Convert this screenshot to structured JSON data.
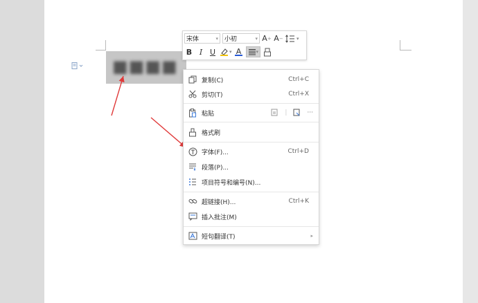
{
  "toolbar": {
    "font_name": "宋体",
    "font_size": "小初",
    "bold": "B",
    "italic": "I",
    "underline": "U",
    "grow_font": "A",
    "shrink_font": "A",
    "font_color_glyph": "A"
  },
  "menu": {
    "copy": {
      "label": "复制(C)",
      "shortcut": "Ctrl+C"
    },
    "cut": {
      "label": "剪切(T)",
      "shortcut": "Ctrl+X"
    },
    "paste": {
      "label": "粘贴",
      "more": "···"
    },
    "format_painter": {
      "label": "格式刷"
    },
    "font": {
      "label": "字体(F)...",
      "shortcut": "Ctrl+D"
    },
    "paragraph": {
      "label": "段落(P)..."
    },
    "bullets": {
      "label": "项目符号和编号(N)..."
    },
    "hyperlink": {
      "label": "超链接(H)...",
      "shortcut": "Ctrl+K"
    },
    "comment": {
      "label": "插入批注(M)"
    },
    "translate": {
      "label": "短句翻译(T)",
      "submenu": "▸"
    }
  },
  "colors": {
    "arrow": "#e03a3a",
    "font_color_bar": "#2457d6",
    "selection": "#c6c6c6"
  }
}
